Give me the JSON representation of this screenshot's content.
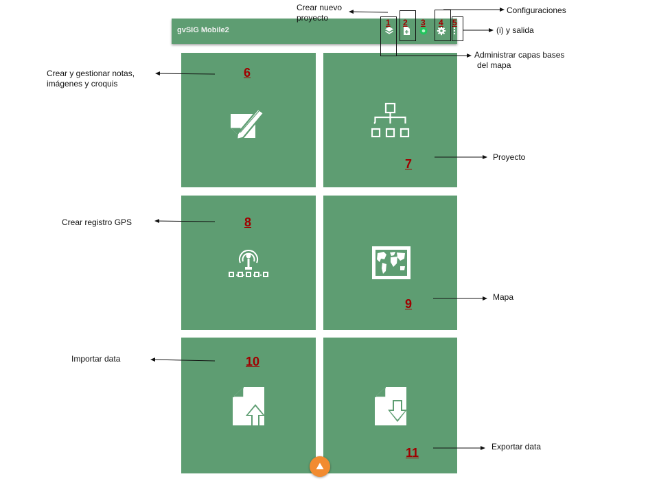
{
  "app": {
    "title": "gvSIG Mobile2",
    "accent_color": "#5e9d72",
    "fab_color": "#f28b30",
    "gps_status_color": "#22c55e",
    "toolbar": [
      {
        "icon": "layers-icon",
        "marker": "1"
      },
      {
        "icon": "new-project-icon",
        "marker": "2"
      },
      {
        "icon": "gps-status-icon",
        "marker": "3"
      },
      {
        "icon": "gear-icon",
        "marker": "4"
      },
      {
        "icon": "overflow-menu-icon",
        "marker": "5"
      }
    ],
    "tiles": [
      {
        "icon": "notes-edit-icon",
        "marker": "6"
      },
      {
        "icon": "project-tree-icon",
        "marker": "7"
      },
      {
        "icon": "gps-log-icon",
        "marker": "8"
      },
      {
        "icon": "world-map-icon",
        "marker": "9"
      },
      {
        "icon": "import-file-icon",
        "marker": "10"
      },
      {
        "icon": "export-file-icon",
        "marker": "11"
      }
    ],
    "fab_icon": "triangle-up-icon"
  },
  "annotations": {
    "crear_nuevo_proyecto": [
      "Crear nuevo",
      "proyecto"
    ],
    "configuraciones": "Configuraciones",
    "info_salida": "(i) y salida",
    "capas_bases": [
      "Administrar capas bases",
      "del mapa"
    ],
    "notas": [
      "Crear y gestionar notas,",
      "imágenes y croquis"
    ],
    "proyecto": "Proyecto",
    "gps": "Crear registro GPS",
    "mapa": "Mapa",
    "importar": "Importar data",
    "exportar": "Exportar data"
  }
}
